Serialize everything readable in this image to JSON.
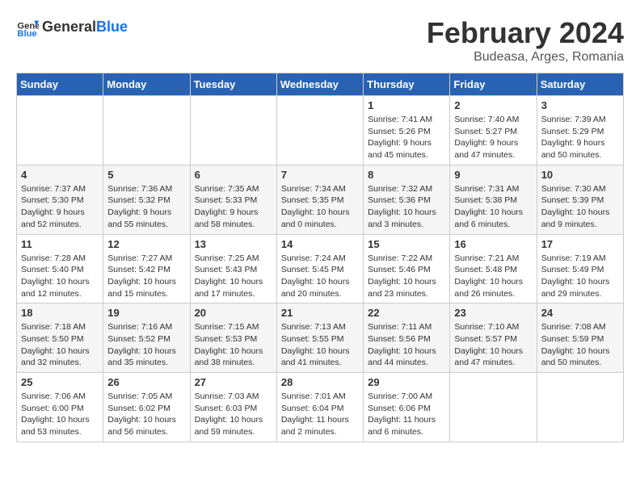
{
  "header": {
    "logo_general": "General",
    "logo_blue": "Blue",
    "month_title": "February 2024",
    "location": "Budeasa, Arges, Romania"
  },
  "weekdays": [
    "Sunday",
    "Monday",
    "Tuesday",
    "Wednesday",
    "Thursday",
    "Friday",
    "Saturday"
  ],
  "weeks": [
    [
      {
        "day": "",
        "content": ""
      },
      {
        "day": "",
        "content": ""
      },
      {
        "day": "",
        "content": ""
      },
      {
        "day": "",
        "content": ""
      },
      {
        "day": "1",
        "content": "Sunrise: 7:41 AM\nSunset: 5:26 PM\nDaylight: 9 hours\nand 45 minutes."
      },
      {
        "day": "2",
        "content": "Sunrise: 7:40 AM\nSunset: 5:27 PM\nDaylight: 9 hours\nand 47 minutes."
      },
      {
        "day": "3",
        "content": "Sunrise: 7:39 AM\nSunset: 5:29 PM\nDaylight: 9 hours\nand 50 minutes."
      }
    ],
    [
      {
        "day": "4",
        "content": "Sunrise: 7:37 AM\nSunset: 5:30 PM\nDaylight: 9 hours\nand 52 minutes."
      },
      {
        "day": "5",
        "content": "Sunrise: 7:36 AM\nSunset: 5:32 PM\nDaylight: 9 hours\nand 55 minutes."
      },
      {
        "day": "6",
        "content": "Sunrise: 7:35 AM\nSunset: 5:33 PM\nDaylight: 9 hours\nand 58 minutes."
      },
      {
        "day": "7",
        "content": "Sunrise: 7:34 AM\nSunset: 5:35 PM\nDaylight: 10 hours\nand 0 minutes."
      },
      {
        "day": "8",
        "content": "Sunrise: 7:32 AM\nSunset: 5:36 PM\nDaylight: 10 hours\nand 3 minutes."
      },
      {
        "day": "9",
        "content": "Sunrise: 7:31 AM\nSunset: 5:38 PM\nDaylight: 10 hours\nand 6 minutes."
      },
      {
        "day": "10",
        "content": "Sunrise: 7:30 AM\nSunset: 5:39 PM\nDaylight: 10 hours\nand 9 minutes."
      }
    ],
    [
      {
        "day": "11",
        "content": "Sunrise: 7:28 AM\nSunset: 5:40 PM\nDaylight: 10 hours\nand 12 minutes."
      },
      {
        "day": "12",
        "content": "Sunrise: 7:27 AM\nSunset: 5:42 PM\nDaylight: 10 hours\nand 15 minutes."
      },
      {
        "day": "13",
        "content": "Sunrise: 7:25 AM\nSunset: 5:43 PM\nDaylight: 10 hours\nand 17 minutes."
      },
      {
        "day": "14",
        "content": "Sunrise: 7:24 AM\nSunset: 5:45 PM\nDaylight: 10 hours\nand 20 minutes."
      },
      {
        "day": "15",
        "content": "Sunrise: 7:22 AM\nSunset: 5:46 PM\nDaylight: 10 hours\nand 23 minutes."
      },
      {
        "day": "16",
        "content": "Sunrise: 7:21 AM\nSunset: 5:48 PM\nDaylight: 10 hours\nand 26 minutes."
      },
      {
        "day": "17",
        "content": "Sunrise: 7:19 AM\nSunset: 5:49 PM\nDaylight: 10 hours\nand 29 minutes."
      }
    ],
    [
      {
        "day": "18",
        "content": "Sunrise: 7:18 AM\nSunset: 5:50 PM\nDaylight: 10 hours\nand 32 minutes."
      },
      {
        "day": "19",
        "content": "Sunrise: 7:16 AM\nSunset: 5:52 PM\nDaylight: 10 hours\nand 35 minutes."
      },
      {
        "day": "20",
        "content": "Sunrise: 7:15 AM\nSunset: 5:53 PM\nDaylight: 10 hours\nand 38 minutes."
      },
      {
        "day": "21",
        "content": "Sunrise: 7:13 AM\nSunset: 5:55 PM\nDaylight: 10 hours\nand 41 minutes."
      },
      {
        "day": "22",
        "content": "Sunrise: 7:11 AM\nSunset: 5:56 PM\nDaylight: 10 hours\nand 44 minutes."
      },
      {
        "day": "23",
        "content": "Sunrise: 7:10 AM\nSunset: 5:57 PM\nDaylight: 10 hours\nand 47 minutes."
      },
      {
        "day": "24",
        "content": "Sunrise: 7:08 AM\nSunset: 5:59 PM\nDaylight: 10 hours\nand 50 minutes."
      }
    ],
    [
      {
        "day": "25",
        "content": "Sunrise: 7:06 AM\nSunset: 6:00 PM\nDaylight: 10 hours\nand 53 minutes."
      },
      {
        "day": "26",
        "content": "Sunrise: 7:05 AM\nSunset: 6:02 PM\nDaylight: 10 hours\nand 56 minutes."
      },
      {
        "day": "27",
        "content": "Sunrise: 7:03 AM\nSunset: 6:03 PM\nDaylight: 10 hours\nand 59 minutes."
      },
      {
        "day": "28",
        "content": "Sunrise: 7:01 AM\nSunset: 6:04 PM\nDaylight: 11 hours\nand 2 minutes."
      },
      {
        "day": "29",
        "content": "Sunrise: 7:00 AM\nSunset: 6:06 PM\nDaylight: 11 hours\nand 6 minutes."
      },
      {
        "day": "",
        "content": ""
      },
      {
        "day": "",
        "content": ""
      }
    ]
  ]
}
